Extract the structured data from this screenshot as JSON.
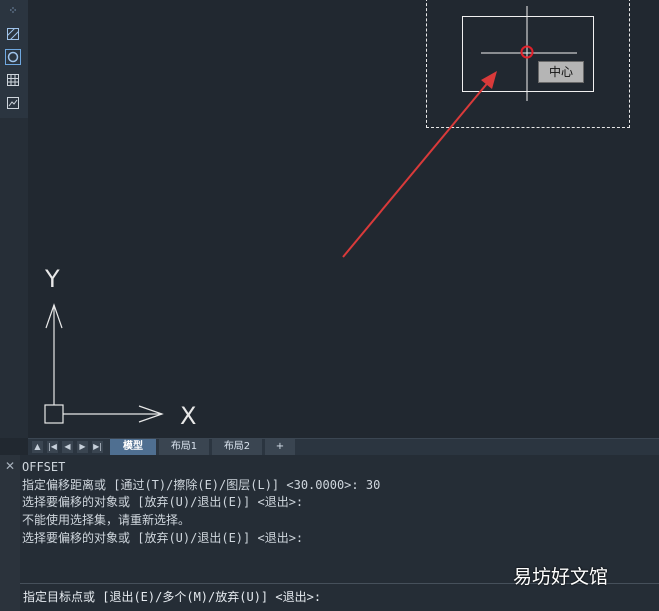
{
  "toolbar": {
    "icons": [
      "snap-points-icon",
      "hatch-icon",
      "circle-icon",
      "table-icon",
      "image-icon"
    ]
  },
  "canvas": {
    "osnap_tooltip": "中心",
    "ucs_x_label": "X",
    "ucs_y_label": "Y"
  },
  "layout_tabs": {
    "nav_first": "▲",
    "nav_prev_end": "|◀",
    "nav_prev": "◀",
    "nav_next": "▶",
    "nav_next_end": "▶|",
    "tabs": [
      "模型",
      "布局1",
      "布局2",
      "+"
    ],
    "active_tab": "模型"
  },
  "command": {
    "close_label": "✕",
    "history": [
      "OFFSET",
      "指定偏移距离或 [通过(T)/擦除(E)/图层(L)] <30.0000>: 30",
      "选择要偏移的对象或 [放弃(U)/退出(E)] <退出>:",
      "不能使用选择集，请重新选择。",
      "选择要偏移的对象或 [放弃(U)/退出(E)] <退出>:"
    ],
    "prompt": "指定目标点或 [退出(E)/多个(M)/放弃(U)] <退出>:"
  },
  "watermark": "易坊好文馆",
  "colors": {
    "background": "#212830",
    "arrow": "#d93a3a",
    "snap_marker": "#e0202a"
  }
}
